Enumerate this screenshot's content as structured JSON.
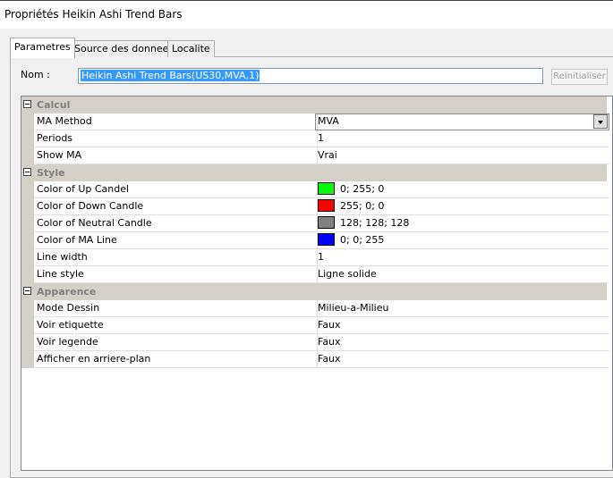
{
  "window": {
    "title": "Propriétés Heikin Ashi Trend Bars"
  },
  "tabs": [
    {
      "label": "Parametres",
      "active": true
    },
    {
      "label": "Source des donnees",
      "active": false
    },
    {
      "label": "Localite",
      "active": false
    }
  ],
  "name_row": {
    "label": "Nom :",
    "value": "Heikin Ashi Trend Bars(US30,MVA,1)",
    "reset_label": "Reinitialiser"
  },
  "categories": {
    "calcul": {
      "label": "Calcul",
      "rows": [
        {
          "name": "MA Method",
          "value": "MVA"
        },
        {
          "name": "Periods",
          "value": "1"
        },
        {
          "name": "Show MA",
          "value": "Vrai"
        }
      ]
    },
    "style": {
      "label": "Style",
      "rows": [
        {
          "name": "Color of Up Candel",
          "value": "0; 255; 0",
          "swatch": "#00ff00"
        },
        {
          "name": "Color of Down Candle",
          "value": "255; 0; 0",
          "swatch": "#ff0000"
        },
        {
          "name": "Color of Neutral Candle",
          "value": "128; 128; 128",
          "swatch": "#808080"
        },
        {
          "name": "Color of MA Line",
          "value": "0; 0; 255",
          "swatch": "#0000ff"
        },
        {
          "name": "Line width",
          "value": "1"
        },
        {
          "name": "Line style",
          "value": "Ligne solide"
        }
      ]
    },
    "apparence": {
      "label": "Apparence",
      "rows": [
        {
          "name": "Mode Dessin",
          "value": "Milieu-a-Milieu"
        },
        {
          "name": "Voir etiquette",
          "value": "Faux"
        },
        {
          "name": "Voir legende",
          "value": "Faux"
        },
        {
          "name": "Afficher en arriere-plan",
          "value": "Faux"
        }
      ]
    }
  }
}
